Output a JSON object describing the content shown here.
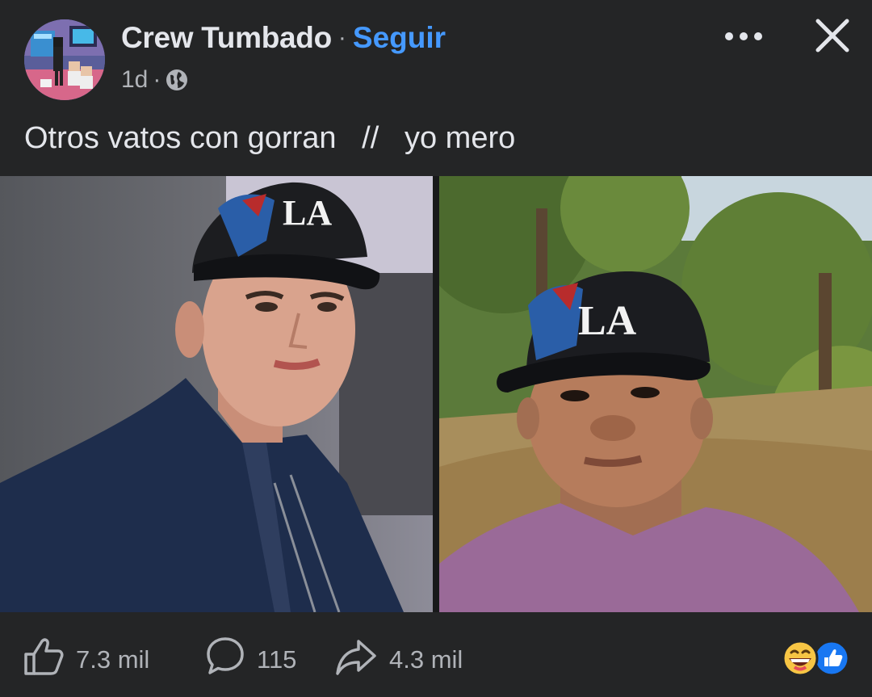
{
  "post": {
    "author": "Crew Tumbado",
    "separator": "·",
    "follow_label": "Seguir",
    "time": "1d",
    "audience_icon": "globe-icon",
    "caption": "Otros vatos con gorran   //   yo mero"
  },
  "footer": {
    "likes": "7.3 mil",
    "comments": "115",
    "shares": "4.3 mil",
    "reaction_icons": [
      "grinning-face-icon",
      "like-reaction-icon"
    ]
  },
  "colors": {
    "background": "#242526",
    "link": "#4599ff",
    "text": "#e4e6eb",
    "secondary_text": "#b0b3b8",
    "like_reaction": "#1877f2",
    "emoji_yellow": "#f7c544"
  }
}
